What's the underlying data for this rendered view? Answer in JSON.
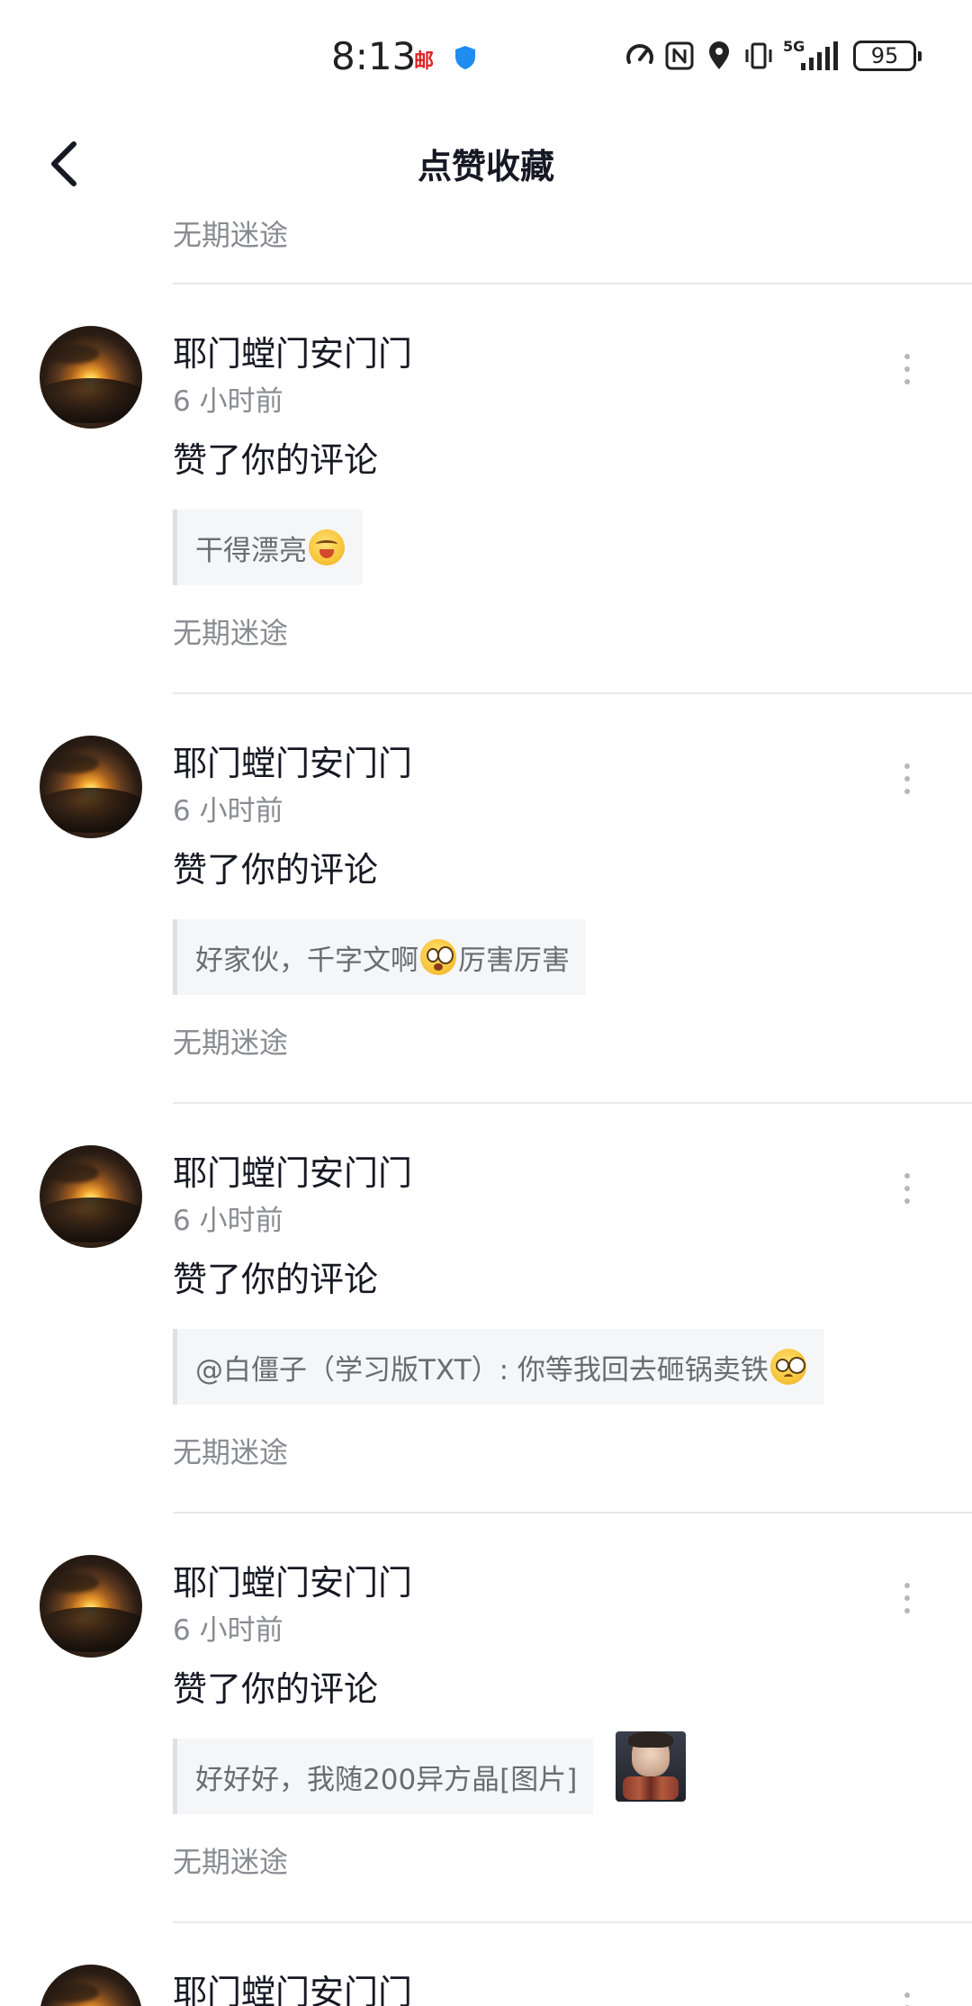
{
  "status_bar": {
    "time": "8:13",
    "mail_glyph": "邮",
    "battery": "95",
    "network": "5G",
    "icons": [
      "speedometer-icon",
      "nfc-icon",
      "location-icon",
      "vibrate-icon",
      "signal-icon",
      "battery-icon"
    ]
  },
  "header": {
    "title": "点赞收藏",
    "back_icon": "chevron-left-icon"
  },
  "partial_top_source": "无期迷途",
  "items": [
    {
      "username": "耶门螳门安门门",
      "time": "6 小时前",
      "action": "赞了你的评论",
      "quote_before": "干得漂亮",
      "quote_emoji": "blush",
      "quote_after": "",
      "source": "无期迷途"
    },
    {
      "username": "耶门螳门安门门",
      "time": "6 小时前",
      "action": "赞了你的评论",
      "quote_before": "好家伙，千字文啊",
      "quote_emoji": "amazed",
      "quote_after": "厉害厉害",
      "source": "无期迷途"
    },
    {
      "username": "耶门螳门安门门",
      "time": "6 小时前",
      "action": "赞了你的评论",
      "quote_before": "@白僵子（学习版TXT）: 你等我回去砸锅卖铁",
      "quote_emoji": "pleading",
      "quote_after": "",
      "source": "无期迷途"
    },
    {
      "username": "耶门螳门安门门",
      "time": "6 小时前",
      "action": "赞了你的评论",
      "quote_before": "好好好，我随200异方晶[图片]",
      "quote_emoji": "",
      "quote_after": "",
      "has_image": true,
      "source": "无期迷途"
    },
    {
      "username": "耶门螳门安门门"
    }
  ],
  "colors": {
    "primary_text": "#161823",
    "secondary_text": "#8a8b91",
    "quote_bg": "#f5f6f8",
    "divider": "#e8e8ea"
  }
}
